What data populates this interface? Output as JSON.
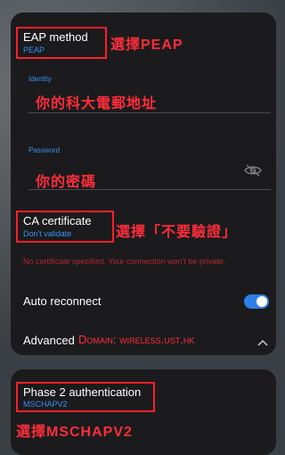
{
  "eap": {
    "title": "EAP method",
    "value": "PEAP",
    "annotation": "選擇PEAP"
  },
  "identity": {
    "label": "Identity",
    "annotation": "你的科大電郵地址"
  },
  "password": {
    "label": "Password",
    "annotation": "你的密碼",
    "icon": "eye-off-icon"
  },
  "ca": {
    "title": "CA certificate",
    "value": "Don't validate",
    "annotation": "選擇「不要驗證」",
    "warning": "No certificate specified. Your connection won't be private."
  },
  "auto_reconnect": {
    "label": "Auto reconnect",
    "enabled": true,
    "color": "#2f7fe8"
  },
  "advanced": {
    "label": "Advanced",
    "annotation": "Domain: wireless.ust.hk"
  },
  "phase2": {
    "title": "Phase 2 authentication",
    "value": "MSCHAPV2",
    "annotation": "選擇MSCHAPV2"
  }
}
